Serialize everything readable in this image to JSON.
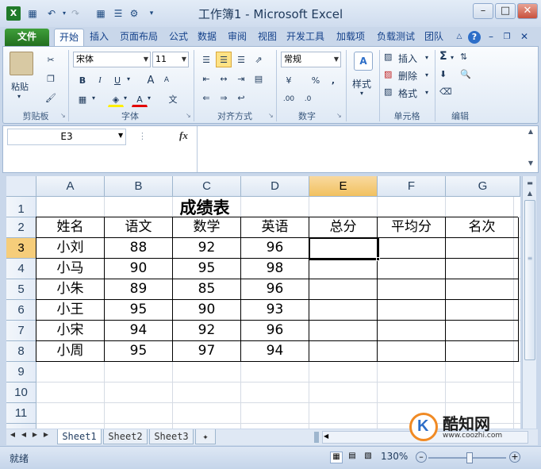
{
  "window": {
    "title": "工作簿1 - Microsoft Excel",
    "qat_icons": [
      "excel-app-icon",
      "save-icon",
      "undo-icon",
      "redo-icon",
      "customize-qat-icon"
    ]
  },
  "ribbon_tabs": [
    "文件",
    "开始",
    "插入",
    "页面布局",
    "公式",
    "数据",
    "审阅",
    "视图",
    "开发工具",
    "加载项",
    "负载测试",
    "团队"
  ],
  "active_tab": "开始",
  "clipboard": {
    "paste_label": "粘贴",
    "group": "剪贴板"
  },
  "font": {
    "name": "宋体",
    "size": "11",
    "group": "字体",
    "bold": "B",
    "italic": "I",
    "underline": "U",
    "grow": "A",
    "shrink": "A"
  },
  "alignment": {
    "group": "对齐方式"
  },
  "number": {
    "format": "常规",
    "group": "数字",
    "percent": "%",
    "comma": ","
  },
  "styles": {
    "label": "样式"
  },
  "cells": {
    "insert": "插入",
    "delete": "删除",
    "format": "格式",
    "group": "单元格"
  },
  "editing": {
    "group": "编辑",
    "sum": "Σ"
  },
  "formula_bar": {
    "name_box": "E3",
    "fx": "fx",
    "value": ""
  },
  "columns": [
    "A",
    "B",
    "C",
    "D",
    "E",
    "F",
    "G"
  ],
  "rows": [
    "1",
    "2",
    "3",
    "4",
    "5",
    "6",
    "7",
    "8",
    "9",
    "10",
    "11"
  ],
  "selected_cell": "E3",
  "table": {
    "title": "成绩表",
    "headers": [
      "姓名",
      "语文",
      "数学",
      "英语",
      "总分",
      "平均分",
      "名次"
    ],
    "data": [
      [
        "小刘",
        "88",
        "92",
        "96"
      ],
      [
        "小马",
        "90",
        "95",
        "98"
      ],
      [
        "小朱",
        "89",
        "85",
        "96"
      ],
      [
        "小王",
        "95",
        "90",
        "93"
      ],
      [
        "小宋",
        "94",
        "92",
        "96"
      ],
      [
        "小周",
        "95",
        "97",
        "94"
      ]
    ]
  },
  "sheets": [
    "Sheet1",
    "Sheet2",
    "Sheet3"
  ],
  "active_sheet": "Sheet1",
  "status": {
    "ready": "就绪",
    "zoom": "130%"
  },
  "watermark": {
    "brand": "酷知网",
    "url": "www.coozhi.com"
  },
  "colors": {
    "file_tab": "#2f8a2b",
    "selection": "#f6cd7a",
    "ribbon_text": "#15428b"
  }
}
